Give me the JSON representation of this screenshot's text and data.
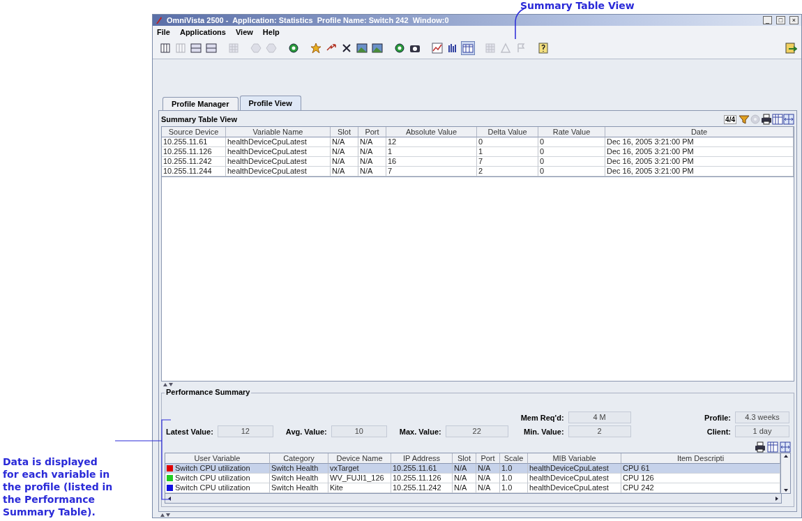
{
  "annotations": [
    {
      "kind": "top",
      "text": "Summary Table View"
    },
    {
      "kind": "side",
      "text": "Data is displayed for each variable in the profile (listed in the Performance Summary Table)."
    }
  ],
  "window": {
    "title": "OmniVista 2500 -  Application: Statistics  Profile Name: Switch 242  Window:0",
    "controls": [
      "_",
      "□",
      "×"
    ]
  },
  "menu": [
    {
      "label": "File"
    },
    {
      "label": "Applications"
    },
    {
      "label": "View"
    },
    {
      "label": "Help"
    }
  ],
  "toolbar": [
    [
      {
        "kind": "panes",
        "disabled": false,
        "selected": false
      },
      {
        "kind": "panes",
        "disabled": true,
        "selected": false
      },
      {
        "kind": "rows",
        "disabled": false,
        "selected": false
      },
      {
        "kind": "rows",
        "disabled": false,
        "selected": false
      }
    ],
    [
      {
        "kind": "grid",
        "disabled": true,
        "selected": false
      }
    ],
    [
      {
        "kind": "hex",
        "disabled": true,
        "selected": false
      },
      {
        "kind": "hex",
        "disabled": true,
        "selected": false
      }
    ],
    [
      {
        "kind": "record",
        "disabled": false,
        "selected": false
      }
    ],
    [
      {
        "kind": "star",
        "disabled": false,
        "selected": false
      },
      {
        "kind": "swap",
        "disabled": false,
        "selected": false
      },
      {
        "kind": "cross",
        "disabled": false,
        "selected": false
      },
      {
        "kind": "picture",
        "disabled": false,
        "selected": false
      },
      {
        "kind": "picture",
        "disabled": false,
        "selected": false
      }
    ],
    [
      {
        "kind": "record",
        "disabled": false,
        "selected": false
      },
      {
        "kind": "camera",
        "disabled": false,
        "selected": false
      }
    ],
    [
      {
        "kind": "linechart",
        "disabled": false,
        "selected": false
      },
      {
        "kind": "bars",
        "disabled": false,
        "selected": false
      },
      {
        "kind": "table",
        "disabled": false,
        "selected": true
      }
    ],
    [
      {
        "kind": "grid",
        "disabled": true,
        "selected": false
      },
      {
        "kind": "triangle",
        "disabled": true,
        "selected": false
      },
      {
        "kind": "flag",
        "disabled": true,
        "selected": false
      }
    ],
    [
      {
        "kind": "help",
        "disabled": false,
        "selected": false
      }
    ]
  ],
  "tabs": [
    {
      "label": "Profile Manager",
      "selected": false
    },
    {
      "label": "Profile View",
      "selected": true
    }
  ],
  "summary": {
    "title": "Summary Table View",
    "count": "4/4",
    "columns": [
      "Source Device",
      "Variable Name",
      "Slot",
      "Port",
      "Absolute Value",
      "Delta Value",
      "Rate Value",
      "Date"
    ],
    "rows": [
      [
        "10.255.11.61",
        "healthDeviceCpuLatest",
        "N/A",
        "N/A",
        "12",
        "0",
        "0",
        "Dec 16, 2005 3:21:00 PM"
      ],
      [
        "10.255.11.126",
        "healthDeviceCpuLatest",
        "N/A",
        "N/A",
        "1",
        "1",
        "0",
        "Dec 16, 2005 3:21:00 PM"
      ],
      [
        "10.255.11.242",
        "healthDeviceCpuLatest",
        "N/A",
        "N/A",
        "16",
        "7",
        "0",
        "Dec 16, 2005 3:21:00 PM"
      ],
      [
        "10.255.11.244",
        "healthDeviceCpuLatest",
        "N/A",
        "N/A",
        "7",
        "2",
        "0",
        "Dec 16, 2005 3:21:00 PM"
      ]
    ]
  },
  "performance": {
    "title": "Performance Summary",
    "stats": [
      {
        "label": "Latest Value:",
        "value": "12"
      },
      {
        "label": "Avg. Value:",
        "value": "10"
      },
      {
        "label": "Max. Value:",
        "value": "22"
      }
    ],
    "memory": [
      {
        "label": "Mem Req'd:",
        "value": "4 M"
      },
      {
        "label": "Min. Value:",
        "value": "2"
      }
    ],
    "profile": [
      {
        "label": "Profile:",
        "value": "4.3 weeks"
      },
      {
        "label": "Client:",
        "value": "1 day"
      }
    ],
    "columns": [
      "User Variable",
      "Category",
      "Device Name",
      "IP Address",
      "Slot",
      "Port",
      "Scale",
      "MIB Variable",
      "Item Descripti"
    ],
    "rows": [
      {
        "color": "#e00000",
        "selected": true,
        "cells": [
          "Switch CPU utilization",
          "Switch Health",
          "vxTarget",
          "10.255.11.61",
          "N/A",
          "N/A",
          "1.0",
          "healthDeviceCpuLatest",
          "CPU 61"
        ]
      },
      {
        "color": "#22cc22",
        "selected": false,
        "cells": [
          "Switch CPU utilization",
          "Switch Health",
          "WV_FUJI1_126",
          "10.255.11.126",
          "N/A",
          "N/A",
          "1.0",
          "healthDeviceCpuLatest",
          "CPU 126"
        ]
      },
      {
        "color": "#1010e0",
        "selected": false,
        "cells": [
          "Switch CPU utilization",
          "Switch Health",
          "Kite",
          "10.255.11.242",
          "N/A",
          "N/A",
          "1.0",
          "healthDeviceCpuLatest",
          "CPU 242"
        ]
      }
    ]
  }
}
